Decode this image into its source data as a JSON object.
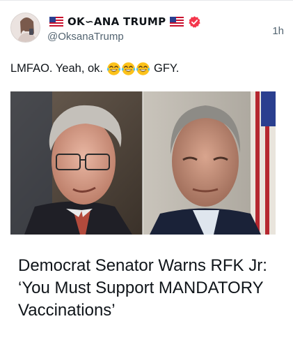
{
  "post": {
    "display_name": "OK∽ANA TRUMP",
    "handle": "@OksanaTrump",
    "timestamp": "1h",
    "text_before": "LMFAO. Yeah, ok.",
    "text_after": "GFY.",
    "emojis": [
      "face-with-tears-of-joy-icon",
      "face-with-tears-of-joy-icon",
      "face-with-tears-of-joy-icon"
    ]
  },
  "article": {
    "headline": "Democrat Senator Warns RFK Jr: ‘You Must Support MANDATORY Vaccinations’"
  },
  "colors": {
    "verified_badge": "#f4364c",
    "text": "#0f1419",
    "secondary_text": "#536471"
  }
}
